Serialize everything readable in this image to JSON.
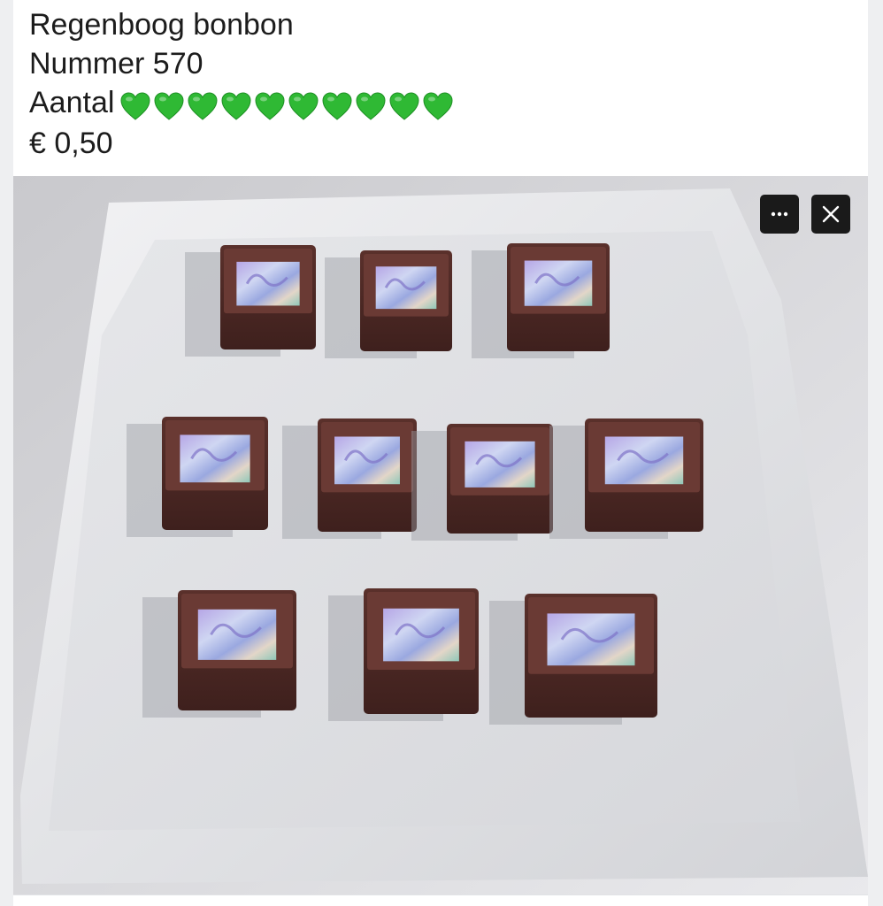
{
  "post": {
    "title": "Regenboog bonbon",
    "number_line": "Nummer 570",
    "quantity_label": "Aantal",
    "quantity_hearts": 10,
    "heart_icon": "green-heart-icon",
    "heart_color": "#2fb934",
    "price": "€ 0,50"
  },
  "photo": {
    "subject": "photo-rainbow-bonbons",
    "bonbon_count": 10
  },
  "overlay": {
    "more_icon": "more-horizontal-icon",
    "close_icon": "close-icon"
  },
  "colors": {
    "page_bg": "#eeeff1",
    "card_bg": "#ffffff",
    "text": "#1c1c1c",
    "overlay_btn": "#1a1a1a",
    "chocolate": "#4f2a26",
    "plate": "#e4e5e8"
  }
}
